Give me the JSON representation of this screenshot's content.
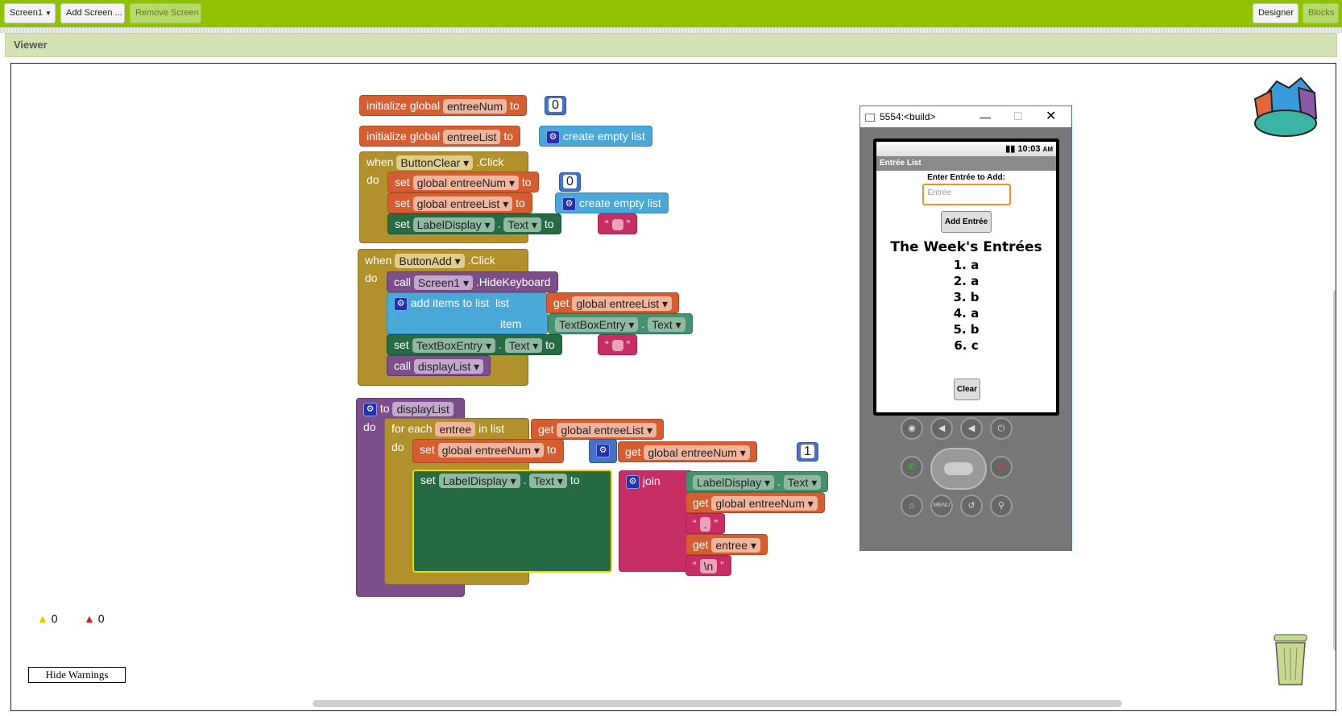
{
  "toolbar": {
    "screen_select": "Screen1",
    "add_screen": "Add Screen ...",
    "remove_screen": "Remove Screen",
    "designer": "Designer",
    "blocks": "Blocks"
  },
  "viewer": {
    "title": "Viewer"
  },
  "blocks": {
    "kw_initialize_global": "initialize global",
    "kw_to": "to",
    "var_num": "entreeNum",
    "var_list": "entreeList",
    "num_zero": "0",
    "create_empty_list": "create empty list",
    "kw_when": "when",
    "kw_do": "do",
    "kw_set": "set",
    "kw_get": "get",
    "kw_call": "call",
    "btn_clear": "ButtonClear",
    "btn_add": "ButtonAdd",
    "ev_click": ".Click",
    "global_num": "global entreeNum",
    "global_list": "global entreeList",
    "label_display": "LabelDisplay",
    "dot": ".",
    "prop_text": "Text",
    "screen1": "Screen1",
    "hide_keyboard": ".HideKeyboard",
    "add_items": "add items to list",
    "kw_list": "list",
    "kw_item": "item",
    "textbox_entry": "TextBoxEntry",
    "display_list": "displayList",
    "for_each": "for each",
    "entree": "entree",
    "in_list": "in list",
    "plus": "+",
    "num_one": "1",
    "join": "join",
    "quote_open": "“",
    "quote_close": "”",
    "str_dot": ".",
    "str_newline": "\\n"
  },
  "emulator": {
    "window_title": "5554:<build>",
    "time": "10:03",
    "ampm": "AM",
    "app_title": "Entrée List",
    "prompt": "Enter Entrée to Add:",
    "input_placeholder": "Entrée",
    "add_button": "Add Entrée",
    "heading": "The Week's Entrées",
    "list": [
      "1. a",
      "2. a",
      "3. b",
      "4. a",
      "5. b",
      "6. c"
    ],
    "clear_button": "Clear",
    "menu_key": "MENU"
  },
  "warnings": {
    "warning_count": "0",
    "error_count": "0",
    "hide_button": "Hide Warnings"
  },
  "icons": [
    "backpack-icon",
    "trash-icon",
    "warning-icon",
    "error-icon"
  ],
  "colors": {
    "toolbar": "#8fc202",
    "procedure": "#7c4f8a",
    "control": "#b0912b",
    "variable": "#d45e32",
    "list": "#4aa8d8",
    "component": "#266b44",
    "text": "#c72e65"
  }
}
